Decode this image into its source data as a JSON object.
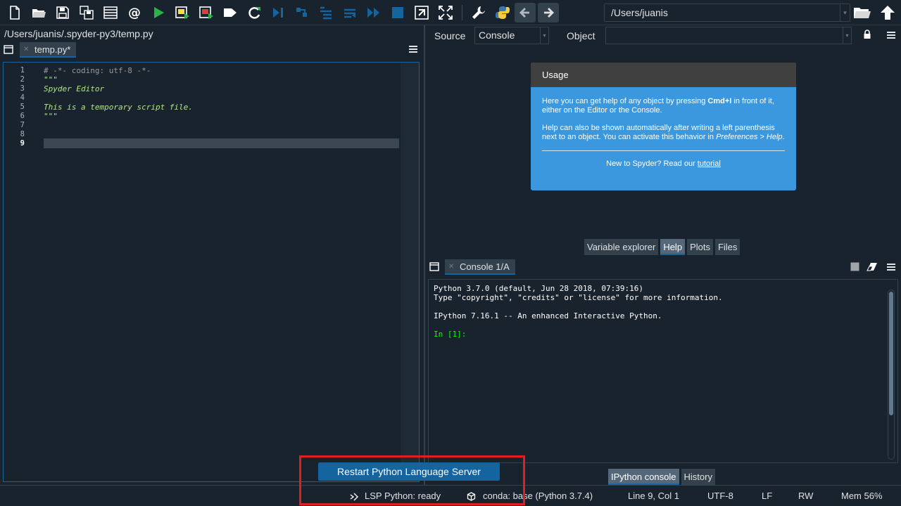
{
  "toolbar": {
    "path": "/Users/juanis",
    "icons": [
      "new-file",
      "open-folder",
      "save",
      "save-all",
      "outline",
      "at-sign",
      "run",
      "run-cell",
      "run-cell-advance",
      "run-selection",
      "rerun",
      "debug",
      "debug-step",
      "debug-continue",
      "debug-step-in",
      "debug-step-over",
      "stop-debug",
      "maximize-pane",
      "fullscreen",
      "preferences-wrench",
      "python-path",
      "back-arrow",
      "forward-arrow",
      "open-directory",
      "parent-directory"
    ]
  },
  "editor": {
    "file_path": "/Users/juanis/.spyder-py3/temp.py",
    "tab_label": "temp.py*",
    "line_numbers": [
      "1",
      "2",
      "3",
      "4",
      "5",
      "6",
      "7",
      "8",
      "9"
    ],
    "lines": [
      "# -*- coding: utf-8 -*-",
      "\"\"\"",
      "Spyder Editor",
      "",
      "This is a temporary script file.",
      "\"\"\"",
      "",
      "",
      ""
    ]
  },
  "help": {
    "source_label": "Source",
    "source_value": "Console",
    "object_label": "Object",
    "card_title": "Usage",
    "para1_a": "Here you can get help of any object by pressing ",
    "para1_key": "Cmd+I",
    "para1_b": " in front of it, either on the Editor or the Console.",
    "para2_a": "Help can also be shown automatically after writing a left parenthesis next to an object. You can activate this behavior in ",
    "para2_em": "Preferences > Help",
    "para2_b": ".",
    "footer_text": "New to Spyder? Read our ",
    "footer_link": "tutorial",
    "tabs": [
      "Variable explorer",
      "Help",
      "Plots",
      "Files"
    ]
  },
  "console": {
    "tab_label": "Console 1/A",
    "lines": [
      "Python 3.7.0 (default, Jun 28 2018, 07:39:16)",
      "Type \"copyright\", \"credits\" or \"license\" for more information.",
      "",
      "IPython 7.16.1 -- An enhanced Interactive Python."
    ],
    "prompt": "In [1]:",
    "bottom_tabs": [
      "IPython console",
      "History"
    ]
  },
  "restart_label": "Restart Python Language Server",
  "status": {
    "lsp": "LSP Python: ready",
    "conda": "conda: base (Python 3.7.4)",
    "position": "Line 9, Col 1",
    "encoding": "UTF-8",
    "eol": "LF",
    "permissions": "RW",
    "memory": "Mem 56%"
  },
  "colors": {
    "background": "#19232d",
    "accent": "#1464a0",
    "help_card": "#3b97de",
    "prompt": "#00ff00",
    "highlight": "#e02020"
  }
}
